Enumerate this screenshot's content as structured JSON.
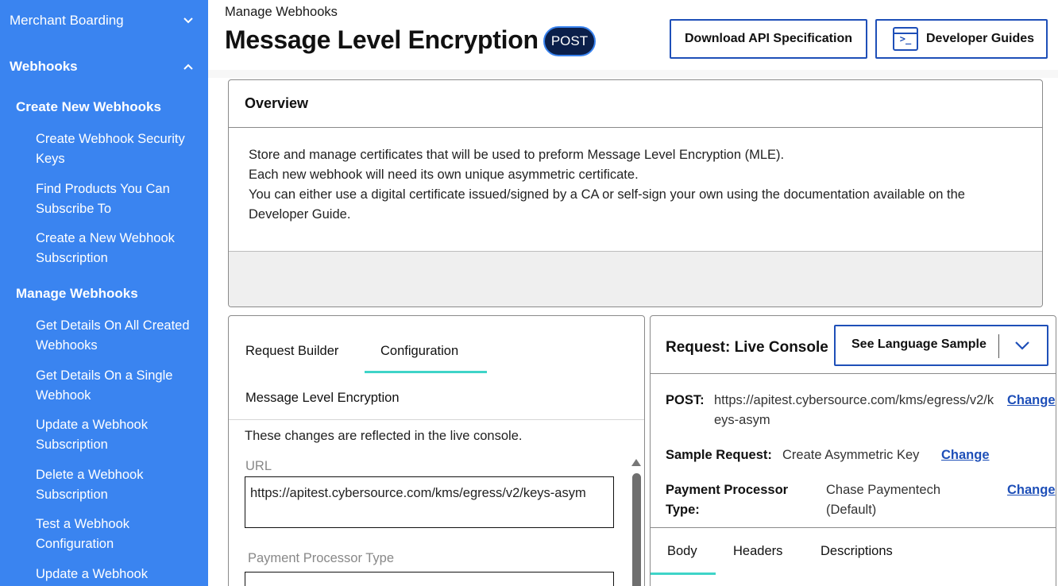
{
  "sidebar": {
    "merchant_boarding": "Merchant Boarding",
    "webhooks": "Webhooks",
    "create_section": "Create New Webhooks",
    "create_items": [
      "Create Webhook Security Keys",
      "Find Products You Can Subscribe To",
      "Create a New Webhook Subscription"
    ],
    "manage_section": "Manage Webhooks",
    "manage_items": [
      "Get Details On All Created Webhooks",
      "Get Details On a Single Webhook",
      "Update a Webhook Subscription",
      "Delete a Webhook Subscription",
      "Test a Webhook Configuration",
      "Update a Webhook"
    ]
  },
  "header": {
    "breadcrumb": "Manage Webhooks",
    "title": "Message Level Encryption",
    "method": "POST",
    "download_label": "Download API Specification",
    "guides_label": "Developer Guides"
  },
  "overview": {
    "title": "Overview",
    "lines": [
      "Store and manage certificates that will be used to preform Message Level Encryption (MLE).",
      "Each new webhook will need its own unique asymmetric certificate.",
      "You can either use a digital certificate issued/signed by a CA or self-sign your own using the documentation available on the Developer Guide."
    ]
  },
  "builder": {
    "tabs": [
      "Request Builder",
      "Configuration"
    ],
    "active_tab": "Configuration",
    "section_label": "Message Level Encryption",
    "note": "These changes are reflected in the live console.",
    "url_label": "URL",
    "url_value": "https://apitest.cybersource.com/kms/egress/v2/keys-asym",
    "ppt_label": "Payment Processor Type",
    "ppt_value": ""
  },
  "console": {
    "title": "Request: Live Console",
    "language_select": "See Language Sample",
    "post_label": "POST:",
    "post_value": "https://apitest.cybersource.com/kms/egress/v2/keys-asym",
    "sample_label": "Sample Request:",
    "sample_value": "Create Asymmetric Key",
    "processor_label": "Payment Processor Type:",
    "processor_value": "Chase Paymentech (Default)",
    "change_label": "Change",
    "tabs": [
      "Body",
      "Headers",
      "Descriptions"
    ],
    "active_tab": "Body"
  },
  "colors": {
    "sidebar": "#3a84f0",
    "accent": "#1e4fb8",
    "tab_underline": "#3fd4c8",
    "badge": "#0b1f4a"
  },
  "icons": {
    "terminal": "terminal-icon",
    "chevron_down": "chevron-down-icon",
    "chevron_up": "chevron-up-icon"
  }
}
